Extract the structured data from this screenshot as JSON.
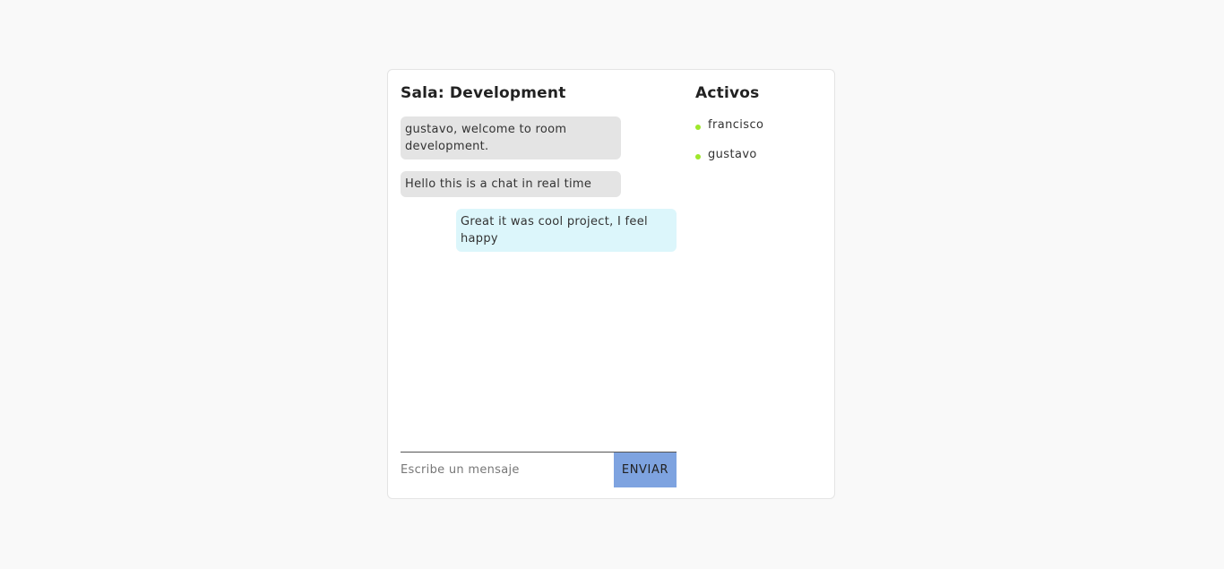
{
  "room": {
    "title": "Sala: Development"
  },
  "messages": [
    {
      "text": "gustavo, welcome to room development.",
      "from": "other"
    },
    {
      "text": "Hello this is a chat in real time",
      "from": "other"
    },
    {
      "text": "Great it was cool project, I feel happy",
      "from": "self"
    }
  ],
  "composer": {
    "placeholder": "Escribe un mensaje",
    "value": "",
    "send_label": "ENVIAR"
  },
  "active_users": {
    "title": "Activos",
    "users": [
      {
        "name": "francisco",
        "status": "online"
      },
      {
        "name": "gustavo",
        "status": "online"
      }
    ]
  },
  "colors": {
    "online": "#9ee82a",
    "bubble_other": "#e4e4e4",
    "bubble_self": "#dcf6fb",
    "send_button": "#7ea3e0"
  }
}
